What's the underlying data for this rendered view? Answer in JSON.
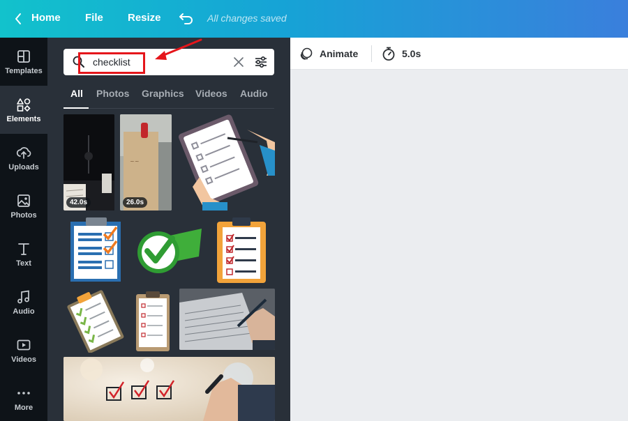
{
  "topbar": {
    "home": "Home",
    "file": "File",
    "resize": "Resize",
    "saved_status": "All changes saved"
  },
  "rail": {
    "items": [
      {
        "label": "Templates",
        "icon": "templates-icon"
      },
      {
        "label": "Elements",
        "icon": "elements-icon"
      },
      {
        "label": "Uploads",
        "icon": "uploads-icon"
      },
      {
        "label": "Photos",
        "icon": "photos-icon"
      },
      {
        "label": "Text",
        "icon": "text-icon"
      },
      {
        "label": "Audio",
        "icon": "audio-icon"
      },
      {
        "label": "Videos",
        "icon": "videos-icon"
      },
      {
        "label": "More",
        "icon": "more-icon"
      }
    ],
    "active": "Elements"
  },
  "panel": {
    "search": {
      "value": "checklist"
    },
    "tabs": [
      {
        "label": "All"
      },
      {
        "label": "Photos"
      },
      {
        "label": "Graphics"
      },
      {
        "label": "Videos"
      },
      {
        "label": "Audio"
      }
    ],
    "active_tab": "All",
    "results": {
      "video_1_duration": "42.0s",
      "video_2_duration": "26.0s"
    }
  },
  "toolbar": {
    "animate": "Animate",
    "duration": "5.0s"
  },
  "colors": {
    "topbar_start": "#12c2cc",
    "topbar_end": "#3a7fdc",
    "rail_bg": "#0e1318",
    "panel_bg": "#293039",
    "highlight": "#e5161b",
    "canvas_bg": "#ebedf0"
  }
}
